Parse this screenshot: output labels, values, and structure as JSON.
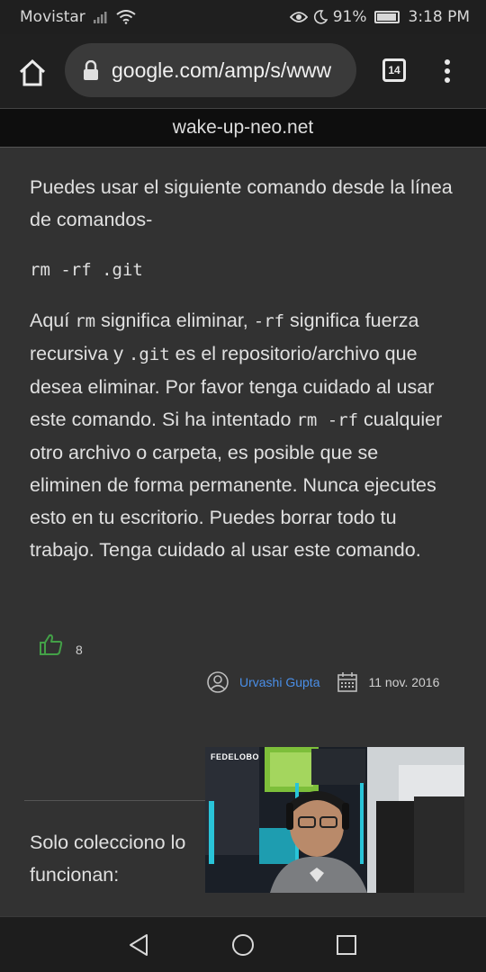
{
  "status_bar": {
    "carrier": "Movistar",
    "battery_percent": "91%",
    "time": "3:18 PM"
  },
  "browser": {
    "url": "google.com/amp/s/www",
    "tab_count": "14",
    "icons": {
      "home": "home-icon",
      "lock": "lock-icon",
      "menu": "overflow-menu-icon"
    }
  },
  "site": {
    "name": "wake-up-neo.net"
  },
  "answer": {
    "intro": "Puedes usar el siguiente comando desde la línea de comandos-",
    "command": "rm -rf .git",
    "exp_1": "Aquí ",
    "code_rm": "rm",
    "exp_2": " significa eliminar, ",
    "code_rf": "-rf",
    "exp_3": " significa fuerza recursiva y ",
    "code_git": ".git",
    "exp_4": " es el repositorio/archivo que desea eliminar. Por favor tenga cuidado al usar este comando. Si ha intentado ",
    "code_rmrf": "rm -rf",
    "exp_5": " cualquier otro archivo o carpeta, es posible que se eliminen de forma permanente. Nunca ejecutes esto en tu escritorio. Puedes borrar todo tu trabajo. Tenga cuidado al usar este comando.",
    "votes": "8",
    "author": "Urvashi Gupta",
    "date": "11 nov. 2016"
  },
  "next_answer": {
    "line1": "Solo colecciono lo",
    "line2": "funcionan:"
  },
  "video": {
    "caption": "FEDELOBO"
  },
  "colors": {
    "accent": "#4a8fe8",
    "upvote": "#43a047",
    "background": "#323232"
  }
}
